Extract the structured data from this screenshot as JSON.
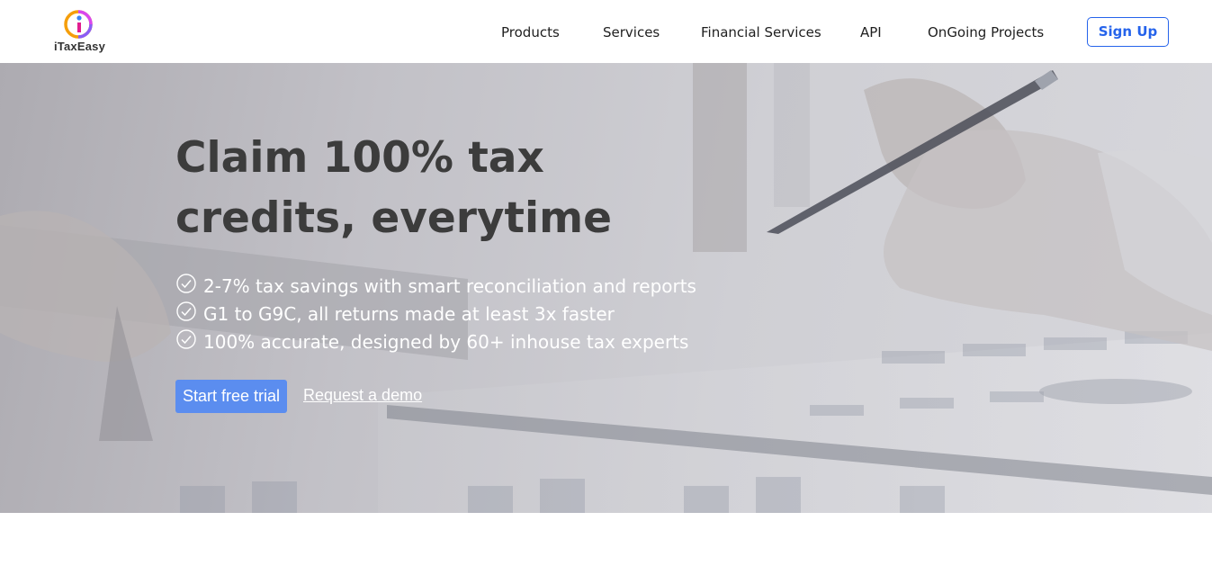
{
  "header": {
    "logo_text": "iTaxEasy",
    "nav": [
      "Products",
      "Services",
      "Financial Services",
      "API",
      "OnGoing Projects"
    ],
    "signup_label": "Sign Up",
    "colors": {
      "accent": "#2563eb",
      "logo_orange": "#f59e0b",
      "logo_magenta": "#d946ef",
      "logo_blue": "#3b82f6"
    }
  },
  "hero": {
    "title_line1": "Claim 100% tax",
    "title_line2": "credits, everytime",
    "features": [
      "2-7% tax savings with smart reconciliation and reports",
      "G1 to G9C, all returns made at least 3x faster",
      "100% accurate, designed by 60+ inhouse tax experts"
    ],
    "primary_cta": "Start free trial",
    "secondary_cta": "Request a demo",
    "colors": {
      "cta": "#5b8def",
      "title": "#3c3c3c",
      "feature_text": "#ffffff"
    },
    "icons": [
      "check-circle-icon"
    ]
  }
}
